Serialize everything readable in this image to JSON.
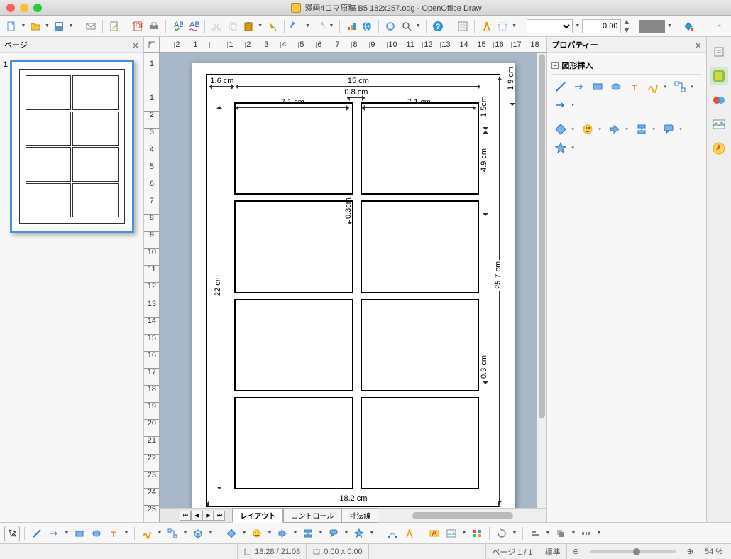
{
  "window": {
    "title": "漫画4コマ原稿 B5 182x257.odg - OpenOffice Draw"
  },
  "panels": {
    "pages_title": "ページ",
    "properties_title": "プロパティー",
    "shape_insert": "図形挿入",
    "thumb_number": "1"
  },
  "toolbar": {
    "line_width_value": "0.00",
    "line_style": ""
  },
  "canvas_tabs": {
    "tab1": "レイアウト",
    "tab2": "コントロール",
    "tab3": "寸法線"
  },
  "dimensions": {
    "top_left": "1.6 cm",
    "top_width": "15 cm",
    "col_width": "7.1 cm",
    "col_width2": "7.1 cm",
    "center_gap": "0.8 cm",
    "right_top_margin": "1.9 cm",
    "right_header": "1.5cm",
    "row_height": "4.9 cm",
    "row_gap": "0.3cm",
    "left_height": "22 cm",
    "right_height": "25.7 cm",
    "row_gap2": "0.3 cm",
    "bottom_width": "18.2 cm"
  },
  "status": {
    "coords": "18.28 / 21.08",
    "size": "0.00 x 0.00",
    "page": "ページ 1 / 1",
    "style": "標準",
    "zoom": "54 %"
  },
  "ruler_h": [
    "2",
    "1",
    "",
    "1",
    "2",
    "3",
    "4",
    "5",
    "6",
    "7",
    "8",
    "9",
    "10",
    "11",
    "12",
    "13",
    "14",
    "15",
    "16",
    "17",
    "18"
  ],
  "ruler_v": [
    "1",
    "",
    "1",
    "2",
    "3",
    "4",
    "5",
    "6",
    "7",
    "8",
    "9",
    "10",
    "10",
    "11",
    "12",
    "13",
    "14",
    "15",
    "16",
    "17",
    "18",
    "18",
    "19",
    "20",
    "21",
    "22",
    "23",
    "24",
    "25"
  ]
}
